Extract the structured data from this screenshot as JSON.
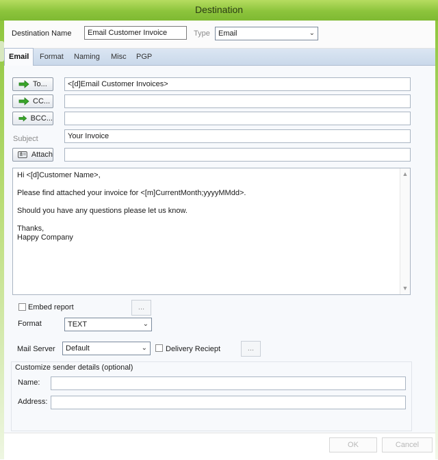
{
  "window": {
    "title": "Destination"
  },
  "header": {
    "destination_name_label": "Destination Name",
    "destination_name_value": "Email Customer Invoice",
    "type_label": "Type",
    "type_value": "Email"
  },
  "tabs": [
    {
      "label": "Email",
      "active": true
    },
    {
      "label": "Format"
    },
    {
      "label": "Naming"
    },
    {
      "label": "Misc"
    },
    {
      "label": "PGP"
    }
  ],
  "email": {
    "to_button": "To...",
    "to_value": "<[d]Email Customer Invoices>",
    "cc_button": "CC...",
    "cc_value": "",
    "bcc_button": "BCC...",
    "bcc_value": "",
    "subject_label": "Subject",
    "subject_value": "Your Invoice",
    "attach_button": "Attach",
    "attach_value": "",
    "body_lines": [
      "Hi <[d]Customer Name>,",
      "",
      "Please find attached your invoice for <[m]CurrentMonth;yyyyMMdd>.",
      "",
      "Should you have any questions please let us know.",
      "",
      "Thanks,",
      "Happy Company"
    ]
  },
  "options": {
    "embed_report_label": "Embed report",
    "embed_report_checked": false,
    "embed_browse_button": "...",
    "format_label": "Format",
    "format_value": "TEXT",
    "mail_server_label": "Mail Server",
    "mail_server_value": "Default",
    "delivery_receipt_label": "Delivery Reciept",
    "delivery_receipt_checked": false,
    "delivery_browse_button": "..."
  },
  "sender": {
    "group_title": "Customize sender details (optional)",
    "name_label": "Name:",
    "name_value": "",
    "address_label": "Address:",
    "address_value": ""
  },
  "footer": {
    "ok_button": "OK",
    "cancel_button": "Cancel"
  },
  "colors": {
    "title_bar": "#8cc43c",
    "arrow_icon": "#3aa52a",
    "tab_bar": "#c9d8ea"
  }
}
